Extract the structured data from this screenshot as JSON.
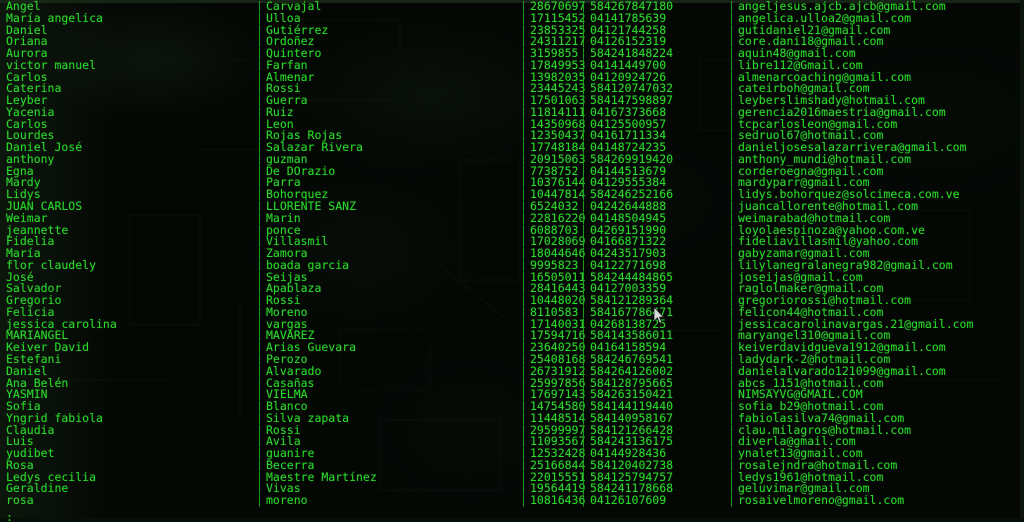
{
  "terminal": {
    "kind": "pager-output",
    "colors": {
      "background": "#050805",
      "foreground": "#2bd92b",
      "separator": "#21a321"
    },
    "prompt": ":",
    "column_separator": "|",
    "rows": [
      {
        "first": "Angel",
        "last": "Carvajal",
        "id": "28670697",
        "phone": "584267847180",
        "email": "angeljesus.ajcb.ajcb@gmail.com"
      },
      {
        "first": "María angelica",
        "last": "Ulloa",
        "id": "17115452",
        "phone": "04141785639",
        "email": "angelica.ulloa2@gmail.com"
      },
      {
        "first": "Daniel",
        "last": "Gutiérrez",
        "id": "23853325",
        "phone": "04121744258",
        "email": "gutidaniel21@gmail.com"
      },
      {
        "first": "Oriana",
        "last": "Ordoñez",
        "id": "24311217",
        "phone": "04126152319",
        "email": "core.dani18@gmail.com"
      },
      {
        "first": "Aurora",
        "last": "Quintero",
        "id": "3159855",
        "phone": "584241848224",
        "email": "aquin48@gmail.com"
      },
      {
        "first": "victor manuel",
        "last": "Farfan",
        "id": "17849953",
        "phone": "04141449700",
        "email": "libre112@Gmail.com"
      },
      {
        "first": "Carlos",
        "last": "Almenar",
        "id": "13982035",
        "phone": "04120924726",
        "email": "almenarcoaching@gmail.com"
      },
      {
        "first": "Caterina",
        "last": "Rossi",
        "id": "23445243",
        "phone": "584120747032",
        "email": "cateirboh@gmail.com"
      },
      {
        "first": "Leyber",
        "last": "Guerra",
        "id": "17501063",
        "phone": "584147598897",
        "email": "leyberslimshady@hotmail.com"
      },
      {
        "first": "Yacenia",
        "last": "Ruiz",
        "id": "11814111",
        "phone": "04167373668",
        "email": "gerencia2016maestria@gmail.com"
      },
      {
        "first": "Carlos",
        "last": "Leon",
        "id": "14350968",
        "phone": "04125500957",
        "email": "tcpcarlosleon@gmail.com"
      },
      {
        "first": "Lourdes",
        "last": "Rojas Rojas",
        "id": "12350437",
        "phone": "04161711334",
        "email": "sedruol67@hotmail.com"
      },
      {
        "first": "Daniel José",
        "last": "Salazar Rivera",
        "id": "17748184",
        "phone": "04148724235",
        "email": "danieljosesalazarrivera@gmail.com"
      },
      {
        "first": "anthony",
        "last": "guzman",
        "id": "20915063",
        "phone": "584269919420",
        "email": "anthony_mundi@hotmail.com"
      },
      {
        "first": "Egna",
        "last": "De DOrazio",
        "id": "7738752",
        "phone": "04144513679",
        "email": "corderoegna@gmail.com"
      },
      {
        "first": "Mardy",
        "last": "Parra",
        "id": "10376144",
        "phone": "04129555384",
        "email": "mardyparr@gmail.com"
      },
      {
        "first": "Lidys",
        "last": "Bohorquez",
        "id": "10447814",
        "phone": "584246252166",
        "email": "lidys.bohorquez@solcimeca.com.ve"
      },
      {
        "first": "JUAN CARLOS",
        "last": "LLORENTE SANZ",
        "id": "6524032",
        "phone": "04242644888",
        "email": "juancallorente@hotmail.com"
      },
      {
        "first": "Weimar",
        "last": "Marin",
        "id": "22816220",
        "phone": "04148504945",
        "email": "weimarabad@hotmail.com"
      },
      {
        "first": "jeannette",
        "last": "ponce",
        "id": "6088703",
        "phone": "04269151990",
        "email": "loyolaespinoza@yahoo.com.ve"
      },
      {
        "first": "Fidelia",
        "last": "Villasmil",
        "id": "17028069",
        "phone": "04166871322",
        "email": "fideliavillasmil@yahoo.com"
      },
      {
        "first": "María",
        "last": "Zamora",
        "id": "18044646",
        "phone": "04243517903",
        "email": "gabyzamar@gmail.com"
      },
      {
        "first": "flor claudely",
        "last": "boada garcia",
        "id": "9995823",
        "phone": "04122771698",
        "email": "lilylanegralanegra982@gmail.com"
      },
      {
        "first": "José",
        "last": "Seijas",
        "id": "16505011",
        "phone": "584244484865",
        "email": "joseijas@gmail.com"
      },
      {
        "first": "Salvador",
        "last": "Apablaza",
        "id": "28416443",
        "phone": "04127003359",
        "email": "raglolmaker@gmail.com"
      },
      {
        "first": "Gregorio",
        "last": "Rossi",
        "id": "10448020",
        "phone": "584121289364",
        "email": "gregoriorossi@hotmail.com"
      },
      {
        "first": "Felicia",
        "last": "Moreno",
        "id": "8110583",
        "phone": "584167786471",
        "email": "felicon44@hotmail.com"
      },
      {
        "first": "jessica carolina",
        "last": "vargas",
        "id": "17140031",
        "phone": "04268138725",
        "email": "jessicacarolinavargas.21@gmail.com"
      },
      {
        "first": "MARIANGEL",
        "last": "MAVAREZ",
        "id": "17594716",
        "phone": "584143586011",
        "email": "maryangel310@gmail.com"
      },
      {
        "first": "Keiver David",
        "last": "Arias Guevara",
        "id": "23640250",
        "phone": "04164158594",
        "email": "keiverdavidgueva1912@gmail.com"
      },
      {
        "first": "Estefani",
        "last": "Perozo",
        "id": "25408168",
        "phone": "584246769541",
        "email": "ladydark-2@hotmail.com"
      },
      {
        "first": "Daniel",
        "last": "Alvarado",
        "id": "26731912",
        "phone": "584264126002",
        "email": "danielalvarado121099@gmail.com"
      },
      {
        "first": "Ana Belén",
        "last": "Casañas",
        "id": "25997856",
        "phone": "584128795665",
        "email": "abcs_1151@hotmail.com"
      },
      {
        "first": "YASMIN",
        "last": "VIELMA",
        "id": "17697143",
        "phone": "584263150421",
        "email": "NIMSAYVG@GMAIL.COM"
      },
      {
        "first": "Sofia",
        "last": "Blanco",
        "id": "14754580",
        "phone": "584144119440",
        "email": "sofia_b29@hotmail.com"
      },
      {
        "first": "Yngrid fabiola",
        "last": "Silva zapata",
        "id": "11448514",
        "phone": "584140958167",
        "email": "fabiolasilva74@gmail.com"
      },
      {
        "first": "Claudia",
        "last": "Rossi",
        "id": "29599997",
        "phone": "584121266428",
        "email": "clau.milagros@hotmail.com"
      },
      {
        "first": "Luis",
        "last": "Avila",
        "id": "11093567",
        "phone": "584243136175",
        "email": "diverla@gmail.com"
      },
      {
        "first": "yudibet",
        "last": "guanire",
        "id": "12532428",
        "phone": "04144928436",
        "email": "ynalet13@gmail.com"
      },
      {
        "first": "Rosa",
        "last": "Becerra",
        "id": "25166844",
        "phone": "584120402738",
        "email": "rosalejndra@hotmail.com"
      },
      {
        "first": "Ledys cecilia",
        "last": "Maestre Martínez",
        "id": "22015551",
        "phone": "584125794757",
        "email": "ledys1961@hotmail.com"
      },
      {
        "first": "Geraldine",
        "last": "Vivas",
        "id": "19564419",
        "phone": "584241178668",
        "email": "geluvimar@gmail.com"
      },
      {
        "first": "rosa",
        "last": "moreno",
        "id": "10816436",
        "phone": "04126107609",
        "email": "rosaivelmoreno@gmail.com"
      }
    ]
  }
}
